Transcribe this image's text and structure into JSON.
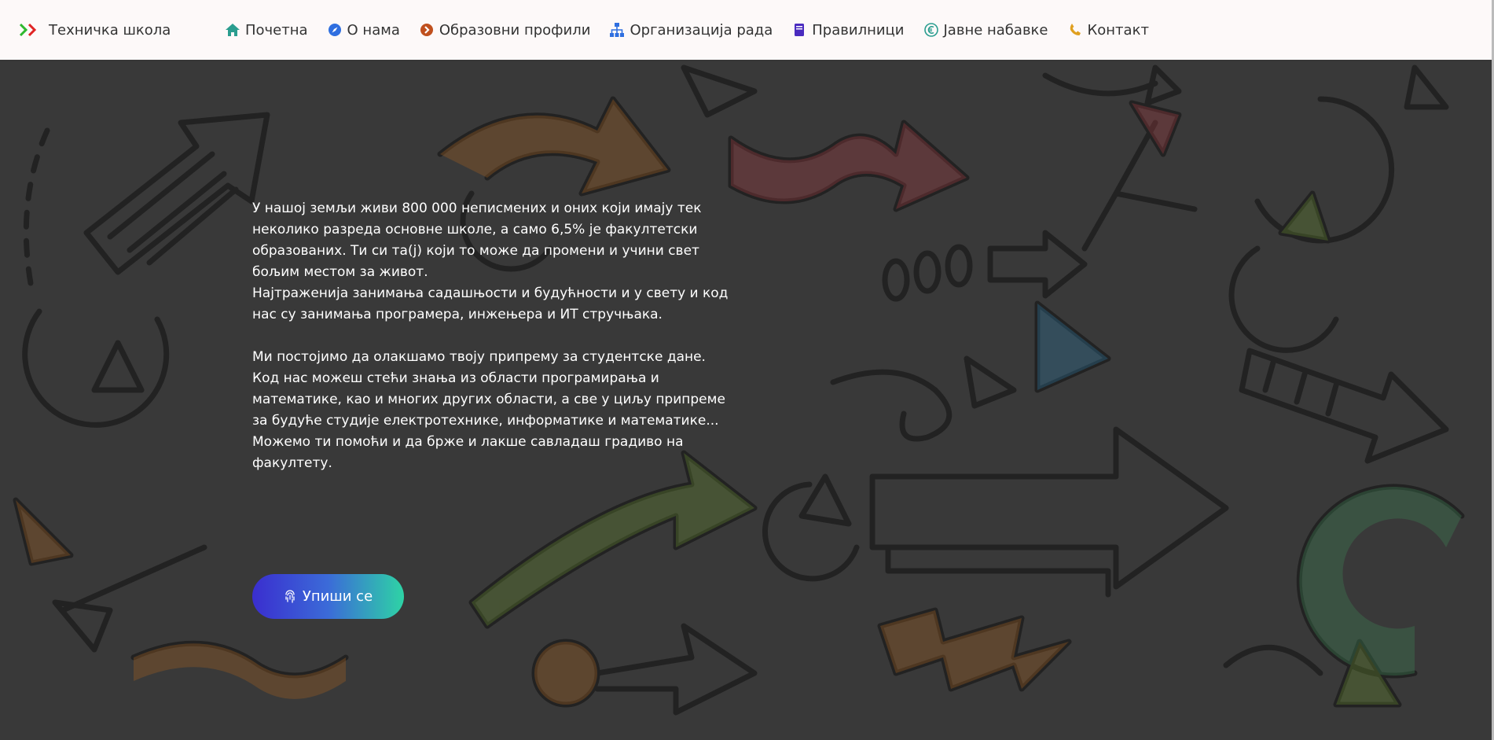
{
  "brand": {
    "name": "Техничка школа",
    "logo_colors": [
      "#2eb82e",
      "#e02424"
    ]
  },
  "nav": {
    "items": [
      {
        "label": "Почетна",
        "icon": "home-icon",
        "color": "#2a9d8f"
      },
      {
        "label": "О нама",
        "icon": "compass-icon",
        "color": "#2f6fe0"
      },
      {
        "label": "Образовни профили",
        "icon": "chevron-circle-icon",
        "color": "#c0501e"
      },
      {
        "label": "Организација рада",
        "icon": "sitemap-icon",
        "color": "#2f6fe0"
      },
      {
        "label": "Правилници",
        "icon": "book-icon",
        "color": "#4a2bbf"
      },
      {
        "label": "Јавне набавке",
        "icon": "euro-icon",
        "color": "#2a9d8f"
      },
      {
        "label": "Контакт",
        "icon": "phone-icon",
        "color": "#e0a020"
      }
    ]
  },
  "hero": {
    "paragraph1": "У нашој земљи живи 800 000 неписмених и оних који имају тек неколико разреда основне школе, а само 6,5% је факултетски образованих. Ти си та(ј) који то може да промени и учини свет бољим местом за живот.",
    "paragraph2": "Најтраженија занимања садашњости и будућности и у свету и код нас су занимања програмера, инжењера и ИТ стручњака.",
    "paragraph3": "Ми постојимо да олакшамо твоју припрему за студентске дане.",
    "paragraph4": "Код нас можеш стећи знања из области програмирања и математике, као и многих других области, а све у циљу припреме за будуће студије електротехнике, информатике и математике...",
    "paragraph5": "Можемо ти помоћи и да брже и лакше савладаш градиво на факултету.",
    "cta_label": "Упиши се",
    "cta_icon": "fingerprint-icon"
  }
}
